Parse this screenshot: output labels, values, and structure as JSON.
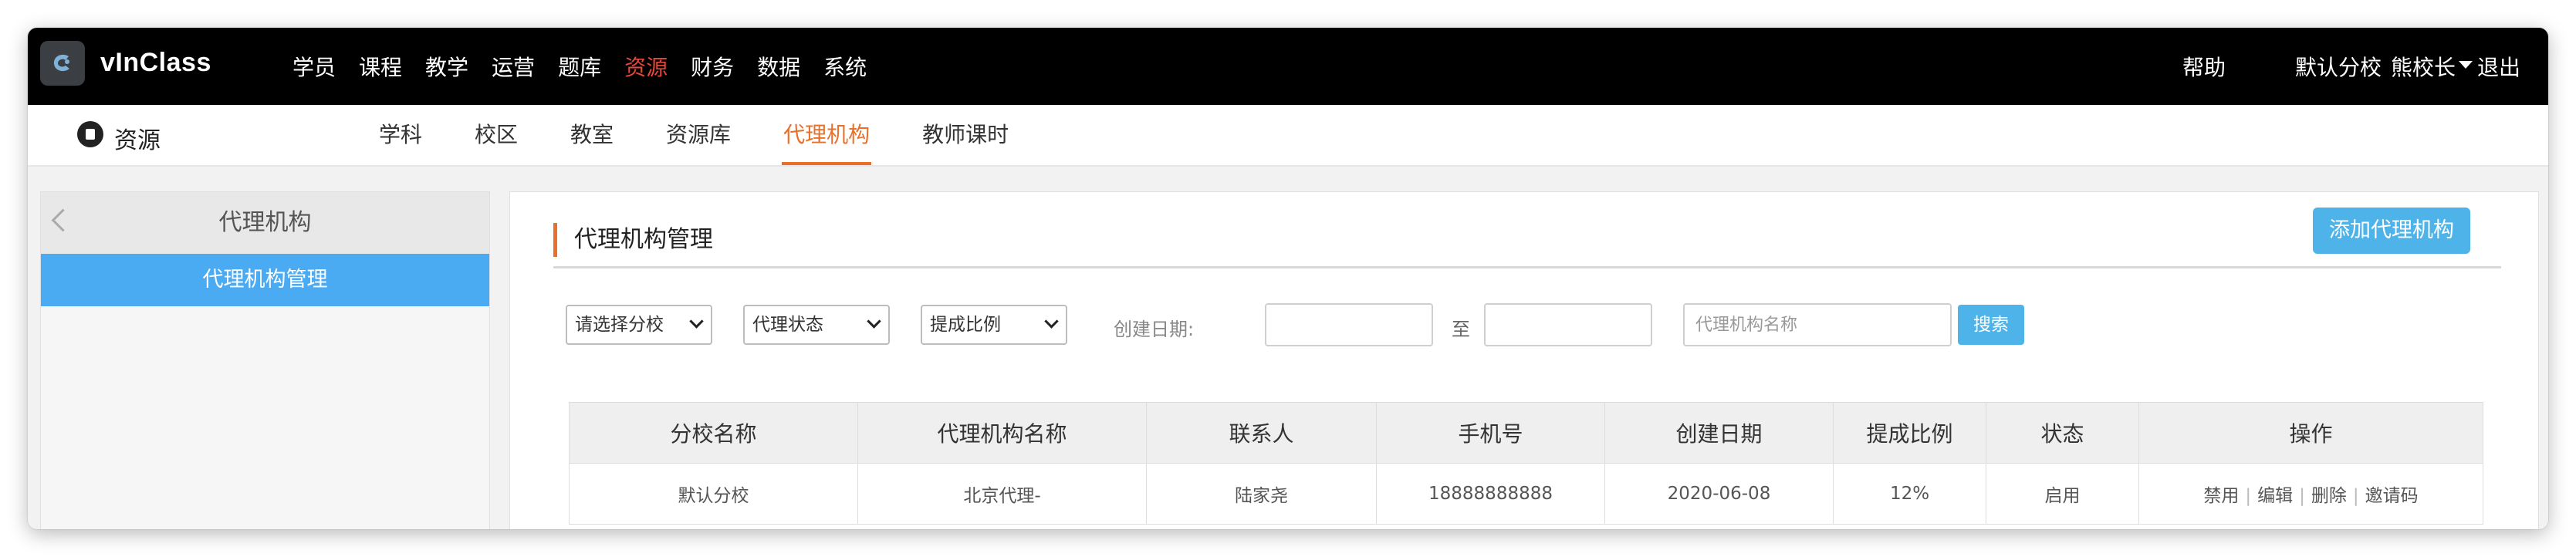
{
  "app": {
    "brand": "vInClass",
    "nav": [
      "学员",
      "课程",
      "教学",
      "运营",
      "题库",
      "资源",
      "财务",
      "数据",
      "系统"
    ],
    "active_nav_index": 5,
    "help": "帮助",
    "campus": "默认分校",
    "user": "熊校长",
    "logout": "退出"
  },
  "subnav": {
    "module_title": "资源",
    "tabs": [
      "学科",
      "校区",
      "教室",
      "资源库",
      "代理机构",
      "教师课时"
    ],
    "active_tab_index": 4
  },
  "sidebar": {
    "title": "代理机构",
    "items": [
      "代理机构管理"
    ]
  },
  "main": {
    "title": "代理机构管理",
    "add_button": "添加代理机构",
    "filters": {
      "campus_select": "请选择分校",
      "status_select": "代理状态",
      "ratio_select": "提成比例",
      "date_label": "创建日期:",
      "date_from": "",
      "to_label": "至",
      "date_to": "",
      "name_placeholder": "代理机构名称",
      "search_button": "搜索"
    },
    "table": {
      "headers": [
        "分校名称",
        "代理机构名称",
        "联系人",
        "手机号",
        "创建日期",
        "提成比例",
        "状态",
        "操作"
      ],
      "rows": [
        {
          "campus": "默认分校",
          "agency": "北京代理-",
          "contact": "陆家尧",
          "phone": "18888888888",
          "created": "2020-06-08",
          "ratio": "12%",
          "status": "启用",
          "actions": [
            "禁用",
            "编辑",
            "删除",
            "邀请码"
          ]
        }
      ]
    }
  },
  "colors": {
    "accent_orange": "#e8702a",
    "active_red": "#e5473b",
    "primary_blue": "#4aaaf2",
    "button_blue": "#4db3e8",
    "topbar_black": "#000000"
  },
  "icons": [
    "logo-icon",
    "module-resource-icon",
    "back-chevron-icon",
    "caret-down-icon"
  ]
}
